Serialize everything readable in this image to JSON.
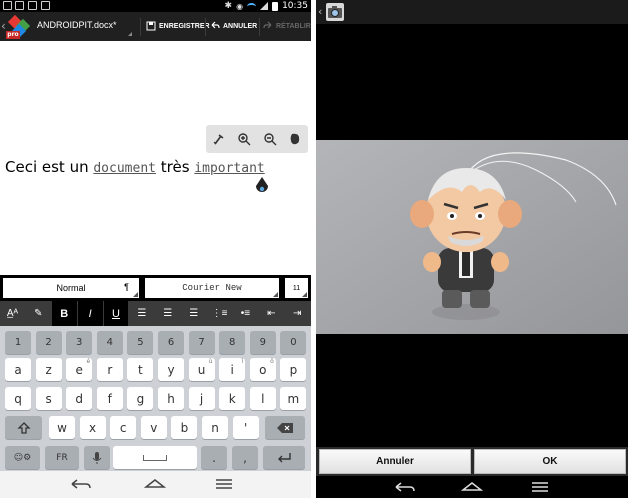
{
  "status": {
    "time": "10:35"
  },
  "actionbar": {
    "doc_title": "ANDROIDPIT.docx*",
    "save_label": "ENREGISTRER",
    "undo_label": "ANNULER",
    "redo_label": "RÉTABLIR",
    "logo_badge": "pro"
  },
  "document": {
    "text_before": "Ceci est un ",
    "word1": "document",
    "text_mid": " très ",
    "word2": "important"
  },
  "zoom_toolbar": {
    "icons": [
      "format-painter-icon",
      "zoom-in-icon",
      "zoom-out-icon",
      "evernote-icon"
    ]
  },
  "format": {
    "style": "Normal",
    "style_mark": "¶",
    "font": "Courier New",
    "size": "11"
  },
  "style_bar": {
    "bold": "B",
    "italic": "I",
    "underline": "U"
  },
  "keyboard": {
    "row_num": [
      "1",
      "2",
      "3",
      "4",
      "5",
      "6",
      "7",
      "8",
      "9",
      "0"
    ],
    "row1": [
      "a",
      "z",
      "e",
      "r",
      "t",
      "y",
      "u",
      "i",
      "o",
      "p"
    ],
    "row1_sup": [
      "",
      "",
      "é",
      "",
      "",
      "",
      "ù",
      "î",
      "ô",
      ""
    ],
    "row2": [
      "q",
      "s",
      "d",
      "f",
      "g",
      "h",
      "j",
      "k",
      "l",
      "m"
    ],
    "row3": [
      "w",
      "x",
      "c",
      "v",
      "b",
      "n",
      "'"
    ],
    "lang": "FR",
    "period": ".",
    "comma": ","
  },
  "right": {
    "cancel_label": "Annuler",
    "ok_label": "OK"
  },
  "colors": {
    "statusbar": "#000000",
    "actionbar": "#202020",
    "accent_wifi": "#4fb3ff"
  }
}
